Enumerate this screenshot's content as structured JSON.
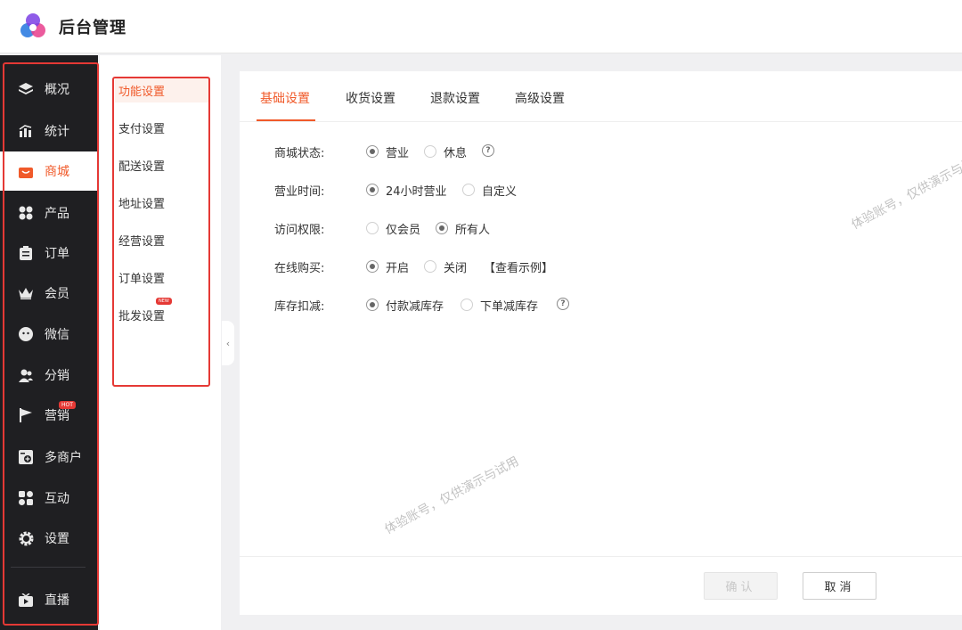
{
  "header": {
    "title": "后台管理"
  },
  "sidebar": {
    "items": [
      {
        "label": "概况",
        "icon": "layers-icon"
      },
      {
        "label": "统计",
        "icon": "chart-icon"
      },
      {
        "label": "商城",
        "icon": "shop-bag-icon",
        "active": true
      },
      {
        "label": "产品",
        "icon": "grid-icon"
      },
      {
        "label": "订单",
        "icon": "clipboard-icon"
      },
      {
        "label": "会员",
        "icon": "crown-icon"
      },
      {
        "label": "微信",
        "icon": "wechat-icon"
      },
      {
        "label": "分销",
        "icon": "users-icon"
      },
      {
        "label": "营销",
        "icon": "flag-icon",
        "badge": "HOT"
      },
      {
        "label": "多商户",
        "icon": "store-plus-icon"
      },
      {
        "label": "互动",
        "icon": "interact-icon"
      },
      {
        "label": "设置",
        "icon": "gear-icon"
      },
      {
        "label": "直播",
        "icon": "tv-icon"
      }
    ]
  },
  "submenu": {
    "items": [
      {
        "label": "功能设置",
        "active": true
      },
      {
        "label": "支付设置"
      },
      {
        "label": "配送设置"
      },
      {
        "label": "地址设置"
      },
      {
        "label": "经营设置"
      },
      {
        "label": "订单设置"
      },
      {
        "label": "批发设置",
        "badge": "NEW"
      }
    ]
  },
  "tabs": [
    {
      "label": "基础设置",
      "active": true
    },
    {
      "label": "收货设置"
    },
    {
      "label": "退款设置"
    },
    {
      "label": "高级设置"
    }
  ],
  "form": {
    "status": {
      "label": "商城状态:",
      "options": [
        "营业",
        "休息"
      ],
      "selected": 0
    },
    "hours": {
      "label": "营业时间:",
      "options": [
        "24小时营业",
        "自定义"
      ],
      "selected": 0
    },
    "access": {
      "label": "访问权限:",
      "options": [
        "仅会员",
        "所有人"
      ],
      "selected": 1
    },
    "online_buy": {
      "label": "在线购买:",
      "options": [
        "开启",
        "关闭"
      ],
      "selected": 0,
      "link": "【查看示例】"
    },
    "stock": {
      "label": "库存扣减:",
      "options": [
        "付款减库存",
        "下单减库存"
      ],
      "selected": 0
    }
  },
  "buttons": {
    "confirm": "确认",
    "cancel": "取消"
  },
  "watermarks": [
    "体验账号，仅供演示与试用",
    "体验账号，仅供演示与试用"
  ],
  "colors": {
    "accent": "#f05a2a",
    "sidebar_bg": "#1f1f22",
    "outline": "#e53935"
  }
}
